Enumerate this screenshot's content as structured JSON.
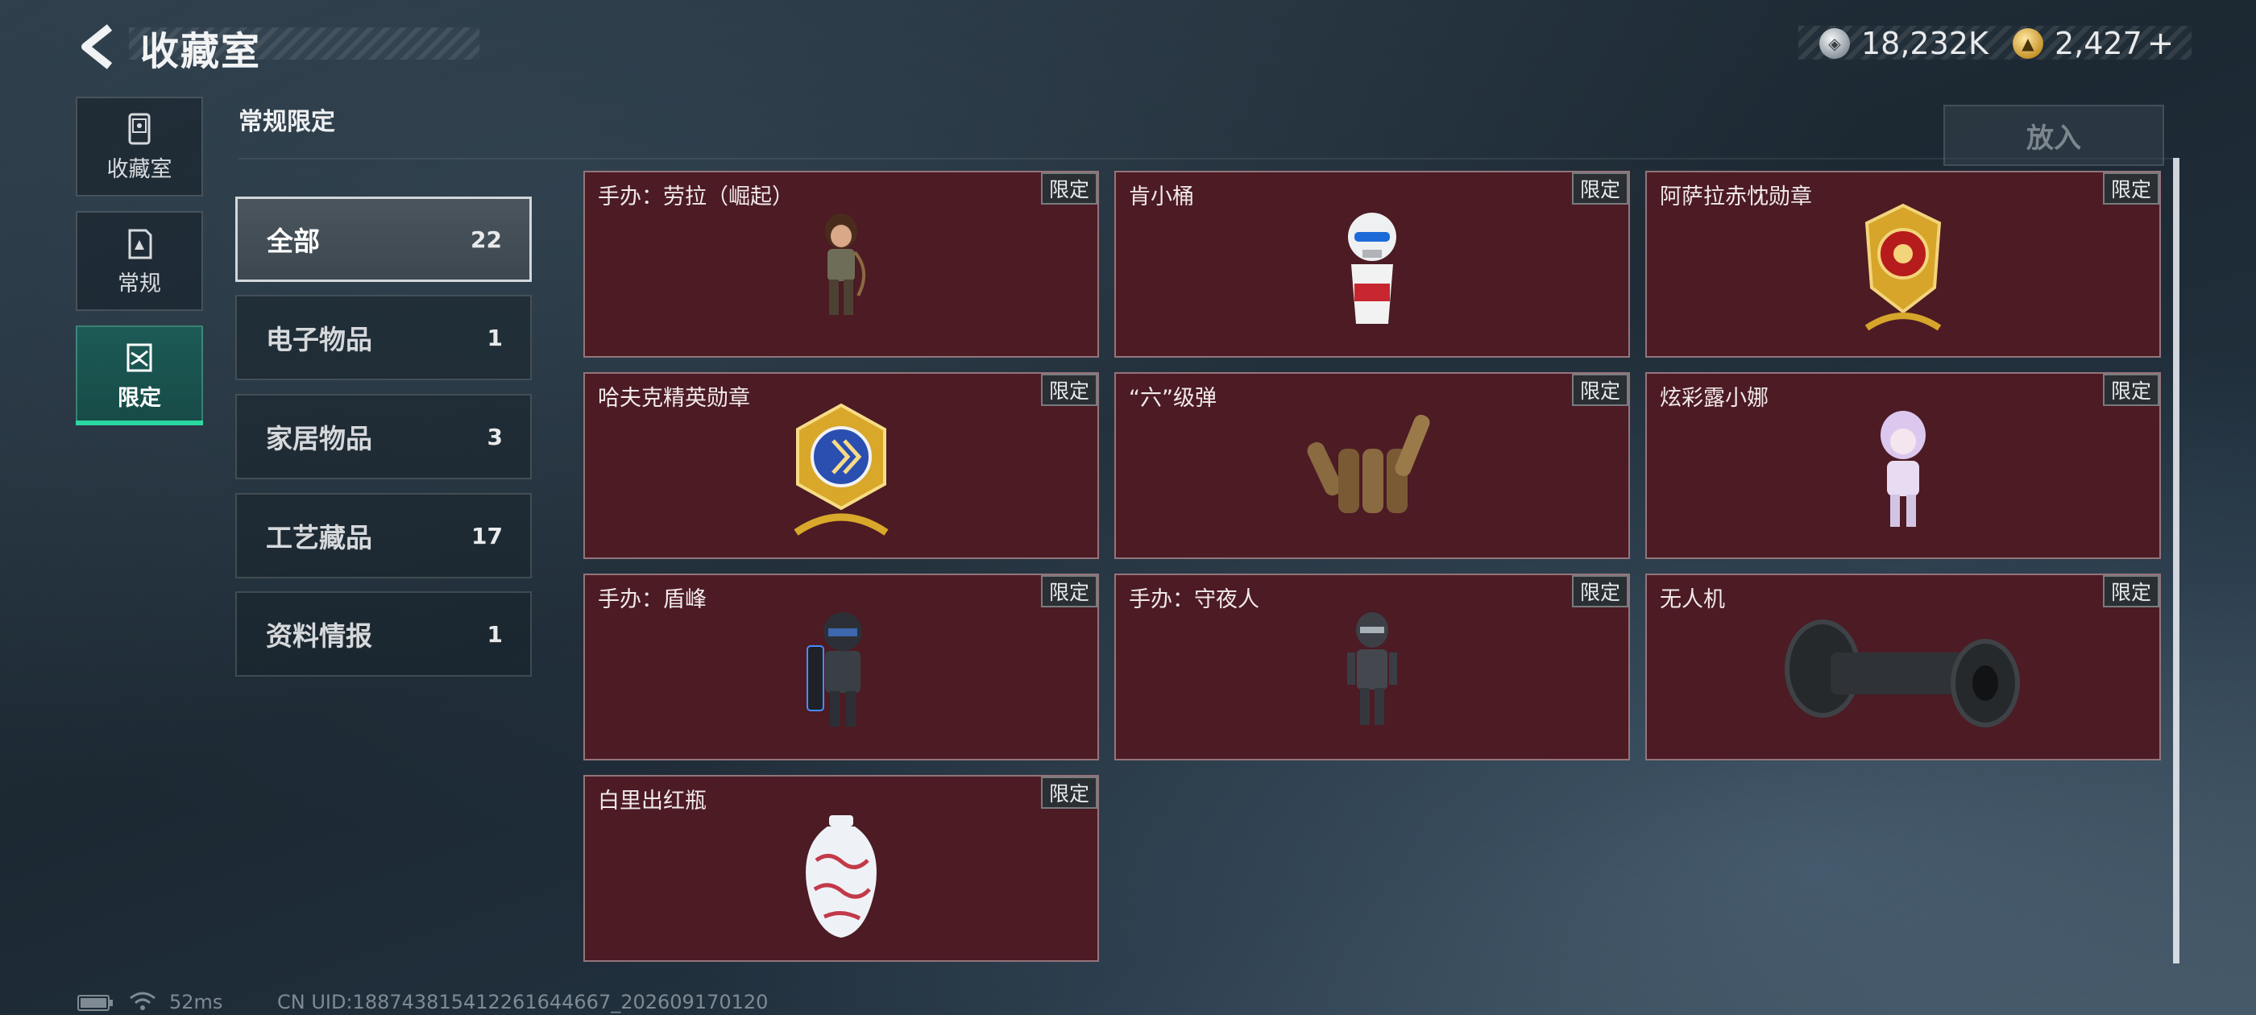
{
  "header": {
    "title": "收藏室",
    "currency": [
      {
        "icon": "silver-coin-icon",
        "value": "18,232K"
      },
      {
        "icon": "gold-coin-icon",
        "value": "2,427"
      }
    ],
    "add_label": "+"
  },
  "side_tabs": [
    {
      "label": "收藏室",
      "icon": "collection-room-icon"
    },
    {
      "label": "常规",
      "icon": "regular-icon"
    },
    {
      "label": "限定",
      "icon": "limited-icon",
      "active": true
    }
  ],
  "section_title": "常规限定",
  "place_button": "放入",
  "categories": [
    {
      "name": "全部",
      "count": "22",
      "active": true
    },
    {
      "name": "电子物品",
      "count": "1"
    },
    {
      "name": "家居物品",
      "count": "3"
    },
    {
      "name": "工艺藏品",
      "count": "17"
    },
    {
      "name": "资料情报",
      "count": "1"
    }
  ],
  "items": [
    {
      "name": "手办：劳拉（崛起）",
      "tag": "限定",
      "icon": "lara-figure-icon"
    },
    {
      "name": "肯小桶",
      "tag": "限定",
      "icon": "kfc-bucket-figure-icon"
    },
    {
      "name": "阿萨拉赤忱勋章",
      "tag": "限定",
      "icon": "medal-red-icon"
    },
    {
      "name": "哈夫克精英勋章",
      "tag": "限定",
      "icon": "medal-blue-icon"
    },
    {
      "name": "“六”级弹",
      "tag": "限定",
      "icon": "bullet-hand-icon"
    },
    {
      "name": "炫彩露小娜",
      "tag": "限定",
      "icon": "luna-figure-icon"
    },
    {
      "name": "手办：盾峰",
      "tag": "限定",
      "icon": "shield-figure-icon"
    },
    {
      "name": "手办：守夜人",
      "tag": "限定",
      "icon": "nightwatch-figure-icon"
    },
    {
      "name": "无人机",
      "tag": "限定",
      "icon": "drone-wheel-icon"
    },
    {
      "name": "白里出红瓶",
      "tag": "限定",
      "icon": "porcelain-vase-icon"
    }
  ],
  "status_bar": {
    "ping": "52ms",
    "uid": "CN UID:188743815412261644667_202609170120"
  }
}
